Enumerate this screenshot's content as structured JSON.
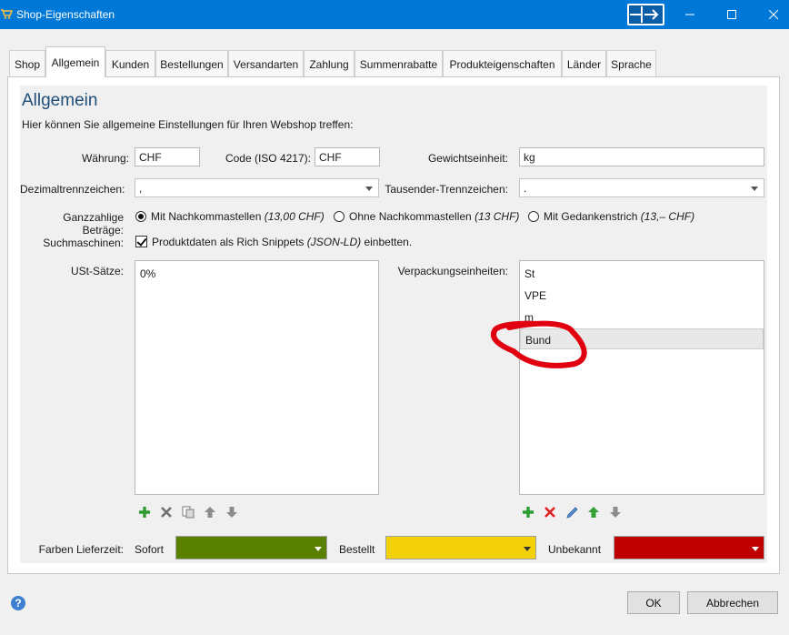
{
  "window": {
    "title": "Shop-Eigenschaften"
  },
  "tabs": [
    {
      "label": "Shop"
    },
    {
      "label": "Allgemein"
    },
    {
      "label": "Kunden"
    },
    {
      "label": "Bestellungen"
    },
    {
      "label": "Versandarten"
    },
    {
      "label": "Zahlung"
    },
    {
      "label": "Summenrabatte"
    },
    {
      "label": "Produkteigenschaften"
    },
    {
      "label": "Länder"
    },
    {
      "label": "Sprache"
    }
  ],
  "active_tab": "Allgemein",
  "section": {
    "title": "Allgemein",
    "intro": "Hier können Sie allgemeine Einstellungen für Ihren Webshop treffen:"
  },
  "form": {
    "currency_label": "Währung:",
    "currency_value": "CHF",
    "code_label": "Code (ISO 4217):",
    "code_value": "CHF",
    "weight_label": "Gewichtseinheit:",
    "weight_value": "kg",
    "decimal_label": "Dezimaltrennzeichen:",
    "decimal_value": ",",
    "thousands_label": "Tausender-Trennzeichen:",
    "thousands_value": ".",
    "integer_label": "Ganzzahlige Beträge:",
    "integer_options": [
      {
        "text": "Mit Nachkommastellen",
        "example": "(13,00 CHF)",
        "selected": true
      },
      {
        "text": "Ohne Nachkommastellen",
        "example": "(13 CHF)",
        "selected": false
      },
      {
        "text": "Mit Gedankenstrich",
        "example": "(13,– CHF)",
        "selected": false
      }
    ],
    "search_label": "Suchmaschinen:",
    "search_check_text": "Produktdaten als Rich Snippets",
    "search_check_em": "(JSON-LD)",
    "search_check_tail": "einbetten.",
    "search_checked": true
  },
  "vat": {
    "label": "USt-Sätze:",
    "items": [
      "0%"
    ]
  },
  "packaging": {
    "label": "Verpackungseinheiten:",
    "items": [
      "St",
      "VPE",
      "m",
      "Bund"
    ],
    "selected": "Bund"
  },
  "delivery_colors": {
    "label": "Farben Lieferzeit:",
    "sofort_label": "Sofort",
    "sofort_color": "#5a8000",
    "bestellt_label": "Bestellt",
    "bestellt_color": "#f2d00a",
    "unbekannt_label": "Unbekannt",
    "unbekannt_color": "#c00000"
  },
  "buttons": {
    "ok": "OK",
    "cancel": "Abbrechen"
  },
  "icons": {
    "vat_toolbar": [
      "add-icon",
      "delete-icon",
      "copy-icon",
      "move-up-icon",
      "move-down-icon"
    ],
    "packaging_toolbar": [
      "add-icon",
      "delete-icon",
      "edit-icon",
      "move-up-icon",
      "move-down-icon"
    ]
  },
  "annotation_color": "#e00010"
}
